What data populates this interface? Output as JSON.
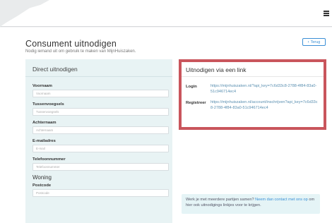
{
  "page": {
    "title": "Consument uitnodigen",
    "subtitle": "Nodig iemand uit om gebruik te maken van MijnHuiszaken.",
    "back_label": "Terug"
  },
  "direct": {
    "heading": "Direct uitnodigen",
    "fields": [
      {
        "label": "Voornaam",
        "placeholder": "Voornaam"
      },
      {
        "label": "Tussenvoegsels",
        "placeholder": "Tussenvoegsels"
      },
      {
        "label": "Achternaam",
        "placeholder": "Achternaam"
      },
      {
        "label": "E-mailadres",
        "placeholder": "E-mail"
      },
      {
        "label": "Telefoonnummer",
        "placeholder": "Telefoonnummer"
      }
    ],
    "section_woning": "Woning",
    "postcode": {
      "label": "Postcode",
      "placeholder": "Postcode"
    }
  },
  "via_link": {
    "heading": "Uitnodigen via een link",
    "login_label": "Login",
    "login_url": "https://mijnhuiszaken.nl/?api_key=7c6d33c8-2788-4f84-83a0-51c946714ec4",
    "register_label": "Registreer",
    "register_url": "https://mijnhuiszaken.nl/account/inschrijven?api_key=7c6d33c8-2788-4f84-83a0-51c946714ec4"
  },
  "info": {
    "text_before": "Werk je met meerdere partijen samen? ",
    "link_text": "Neem dan contact met ons op",
    "text_after": " om hier ook uitnodigings linkjes voor te krijgen."
  },
  "icons": {
    "menu": "hamburger-menu-icon",
    "back": "chevron-left-icon"
  },
  "colors": {
    "accent": "#3a8fd6",
    "highlight_border": "#c9555c",
    "panel_bg": "#e8f3f4"
  }
}
